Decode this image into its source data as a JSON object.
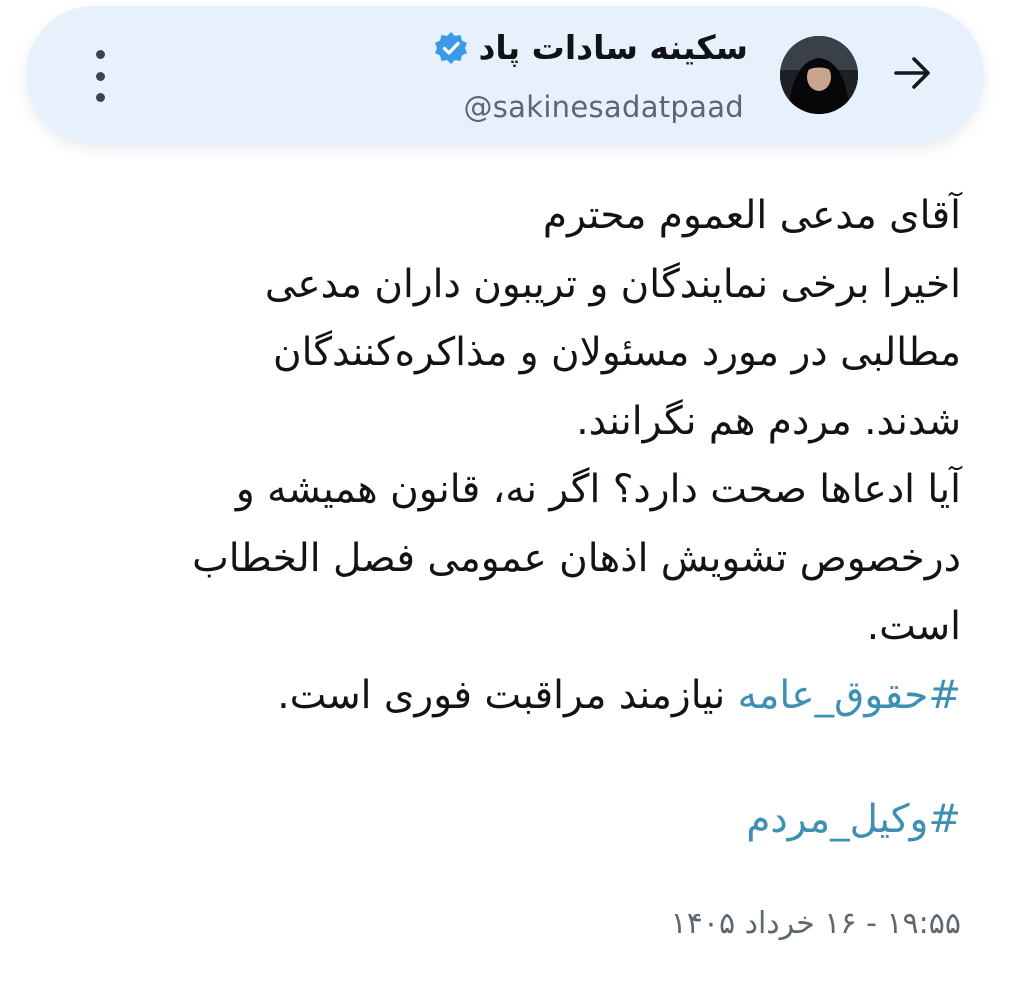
{
  "header": {
    "display_name": "سکینه سادات پاد",
    "handle": "@sakinesadatpaad",
    "verified": true,
    "back_icon": "arrow-right-icon",
    "more_icon": "vertical-dots-icon",
    "accent_color": "#e6f1fc"
  },
  "post": {
    "lines": [
      "آقای مدعی العموم محترم",
      "اخیرا برخی نمایندگان و تریبون داران  مدعی",
      "مطالبی در مورد مسئولان و مذاکره‌کنندگان",
      "شدند. مردم هم نگرانند.",
      "آیا ادعاها صحت دارد؟ اگر نه، قانون همیشه و",
      "درخصوص تشویش اذهان عمومی فصل الخطاب",
      "است."
    ],
    "hashtag_1": "#حقوق_عامه",
    "hashtag_1_suffix": " نیازمند مراقبت فوری است.",
    "hashtag_2": "#وکیل_مردم",
    "hashtag_color": "#3f8fb4",
    "timestamp": "۱۹:۵۵ - ۱۶ خرداد ۱۴۰۵"
  }
}
